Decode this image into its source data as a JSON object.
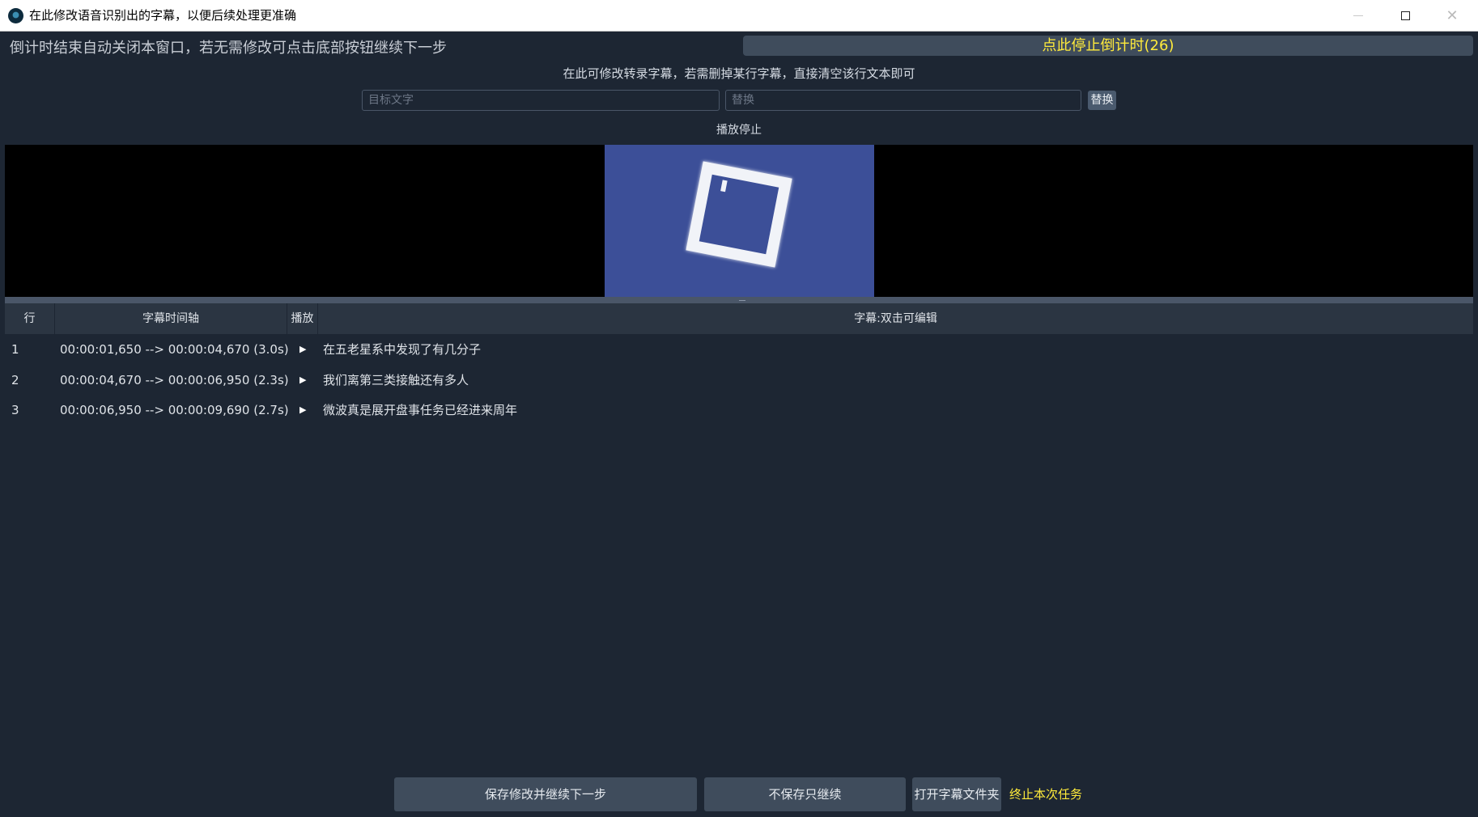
{
  "window": {
    "title": "在此修改语音识别出的字幕，以便后续处理更准确"
  },
  "top": {
    "countdown_text": "倒计时结束自动关闭本窗口，若无需修改可点击底部按钮继续下一步",
    "stop_countdown_label": "点此停止倒计时(26)",
    "hint": "在此可修改转录字幕，若需删掉某行字幕，直接清空该行文本即可"
  },
  "replace": {
    "target_placeholder": "目标文字",
    "replace_placeholder": "替换",
    "button_label": "替换"
  },
  "player": {
    "status": "播放停止"
  },
  "table": {
    "headers": [
      "行",
      "字幕时间轴",
      "播放",
      "字幕:双击可编辑"
    ],
    "rows": [
      {
        "num": "1",
        "time": "00:00:01,650 --> 00:00:04,670 (3.0s)",
        "play": "▶",
        "text": "在五老星系中发现了有几分子"
      },
      {
        "num": "2",
        "time": "00:00:04,670 --> 00:00:06,950 (2.3s)",
        "play": "▶",
        "text": "我们离第三类接触还有多人"
      },
      {
        "num": "3",
        "time": "00:00:06,950 --> 00:00:09,690 (2.7s)",
        "play": "▶",
        "text": "微波真是展开盘事任务已经进来周年"
      }
    ]
  },
  "bottom": {
    "save_label": "保存修改并继续下一步",
    "nosave_label": "不保存只继续",
    "folder_label": "打开字幕文件夹",
    "terminate_label": "终止本次任务"
  },
  "colors": {
    "background": "#1d2633",
    "accent_yellow": "#ffeb3b",
    "button": "#3f4c5c"
  }
}
